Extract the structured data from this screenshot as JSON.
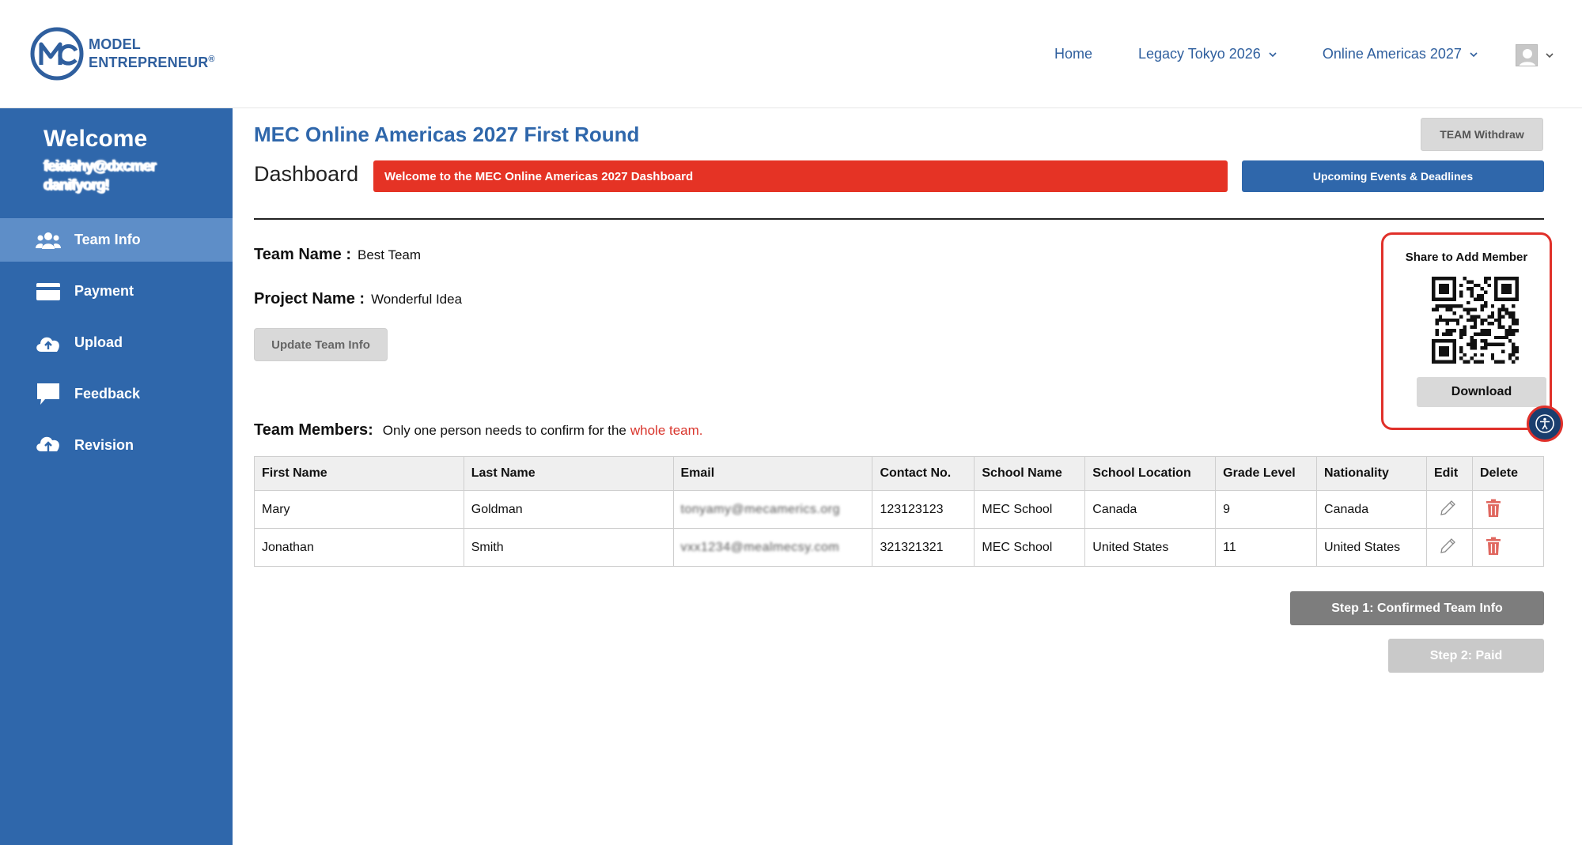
{
  "brand": {
    "line1": "MODEL",
    "line2": "ENTREPRENEUR",
    "reg": "®"
  },
  "nav": {
    "home": "Home",
    "legacy": "Legacy Tokyo 2026",
    "online": "Online Americas 2027"
  },
  "sidebar": {
    "welcome": "Welcome",
    "email_line1": "feialahy@dxcmer",
    "email_line2": "danifyorg!",
    "items": [
      {
        "label": "Team Info",
        "icon": "team-icon",
        "active": true
      },
      {
        "label": "Payment",
        "icon": "card-icon",
        "active": false
      },
      {
        "label": "Upload",
        "icon": "cloud-upload-icon",
        "active": false
      },
      {
        "label": "Feedback",
        "icon": "chat-icon",
        "active": false
      },
      {
        "label": "Revision",
        "icon": "cloud-upload-icon",
        "active": false
      }
    ]
  },
  "main": {
    "title": "MEC Online Americas 2027 First Round",
    "withdraw_label": "TEAM Withdraw",
    "dashboard_label": "Dashboard",
    "welcome_banner": "Welcome to the MEC Online Americas 2027 Dashboard",
    "events_label": "Upcoming Events & Deadlines",
    "team_name_key": "Team Name :",
    "team_name_value": "Best Team",
    "project_name_key": "Project Name :",
    "project_name_value": "Wonderful Idea",
    "update_label": "Update Team Info",
    "share_title": "Share to Add Member",
    "download_label": "Download",
    "members_key": "Team Members:",
    "members_note": "Only one person needs to confirm for the",
    "members_highlight": "whole team.",
    "step1_label": "Step 1: Confirmed Team Info",
    "step2_label": "Step 2: Paid"
  },
  "table": {
    "headers": [
      "First Name",
      "Last Name",
      "Email",
      "Contact No.",
      "School Name",
      "School Location",
      "Grade Level",
      "Nationality",
      "Edit",
      "Delete"
    ],
    "rows": [
      [
        "Mary",
        "Goldman",
        "tonyamy@mecamerics.org",
        "123123123",
        "MEC School",
        "Canada",
        "9",
        "Canada"
      ],
      [
        "Jonathan",
        "Smith",
        "vxx1234@mealmecsy.com",
        "321321321",
        "MEC School",
        "United States",
        "11",
        "United States"
      ]
    ]
  },
  "colors": {
    "brand_blue": "#2f67ab",
    "alert_red": "#e53325",
    "sidebar_active": "#5e8ec8"
  }
}
